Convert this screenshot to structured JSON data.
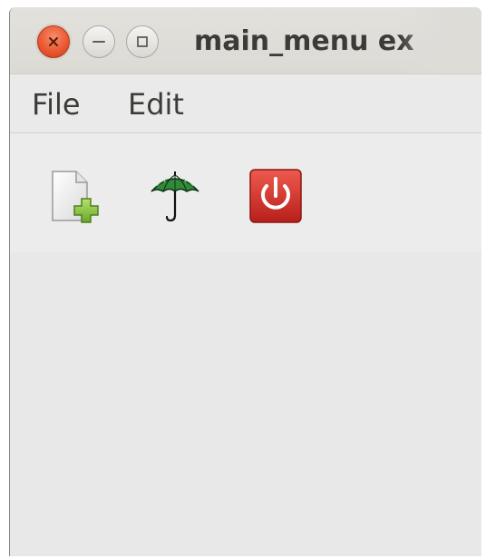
{
  "window": {
    "title": "main_menu ex",
    "controls": {
      "close_icon": "close-x-icon",
      "minimize_icon": "minimize-dash-icon",
      "maximize_icon": "maximize-square-icon"
    },
    "colors": {
      "close_button": "#e9552e",
      "titlebar": "#dfddd8",
      "background": "#ebebeb"
    }
  },
  "menubar": {
    "items": [
      {
        "label": "File"
      },
      {
        "label": "Edit"
      }
    ]
  },
  "toolbar": {
    "buttons": [
      {
        "icon": "new-file-icon"
      },
      {
        "icon": "umbrella-icon"
      },
      {
        "icon": "power-quit-icon"
      }
    ],
    "colors": {
      "new_plus": "#8cc63f",
      "umbrella_canopy": "#2f8a3a",
      "quit_background": "#d8332b"
    }
  }
}
